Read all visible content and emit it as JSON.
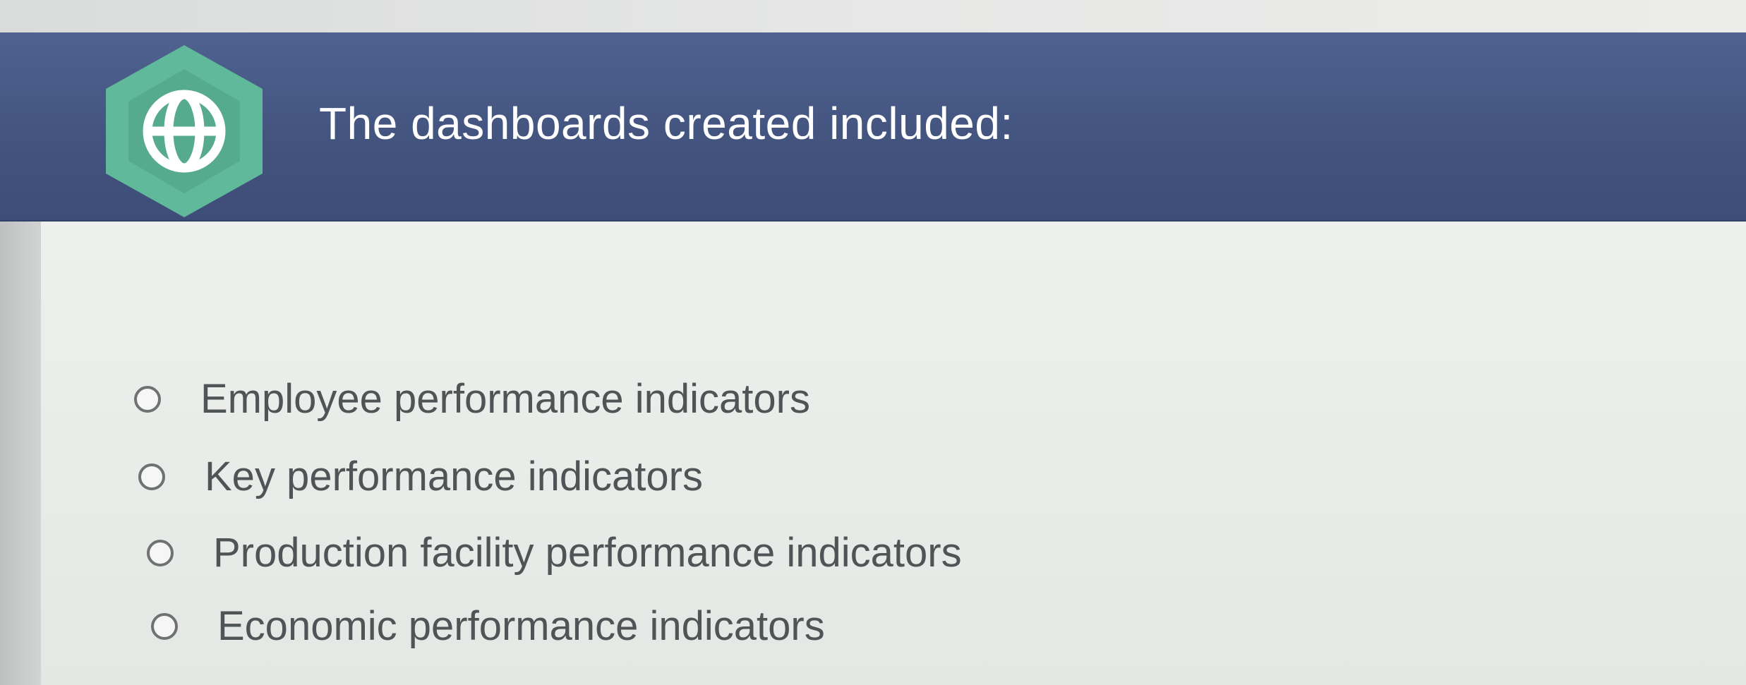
{
  "question": {
    "title": "The dashboards created included:",
    "icon": "globe-icon",
    "badge_color": "#5fb99a",
    "header_color": "#43547f"
  },
  "options": [
    {
      "label": "Employee performance indicators",
      "selected": false
    },
    {
      "label": "Key performance indicators",
      "selected": false
    },
    {
      "label": "Production facility performance indicators",
      "selected": false
    },
    {
      "label": "Economic performance indicators",
      "selected": false
    }
  ]
}
